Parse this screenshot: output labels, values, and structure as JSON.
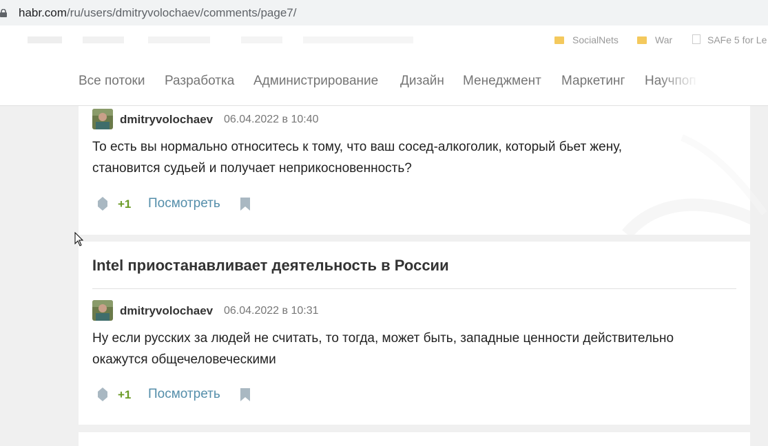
{
  "browser": {
    "url_host": "habr.com",
    "url_path": "/ru/users/dmitryvolochaev/comments/page7/",
    "bookmarks": [
      "SocialNets",
      "War",
      "SAFe 5 for Le"
    ]
  },
  "nav": {
    "items": [
      "Все потоки",
      "Разработка",
      "Администрирование",
      "Дизайн",
      "Менеджмент",
      "Маркетинг",
      "Научпоп"
    ]
  },
  "comments": [
    {
      "author": "dmitryvolochaev",
      "date": "06.04.2022 в 10:40",
      "text": "То есть вы нормально относитесь к тому, что ваш сосед-алкоголик, который бьет жену, становится судьей и получает неприкосновенность?",
      "score": "+1",
      "view_label": "Посмотреть"
    },
    {
      "post_title": "Intel приостанавливает деятельность в России",
      "author": "dmitryvolochaev",
      "date": "06.04.2022 в 10:31",
      "text": "Ну если русских за людей не считать, то тогда, может быть, западные ценности действительно окажутся общечеловеческими",
      "score": "+1",
      "view_label": "Посмотреть"
    }
  ],
  "colors": {
    "score": "#6a9a25",
    "link": "#548eaa",
    "page_bg": "#f0f0f0"
  }
}
